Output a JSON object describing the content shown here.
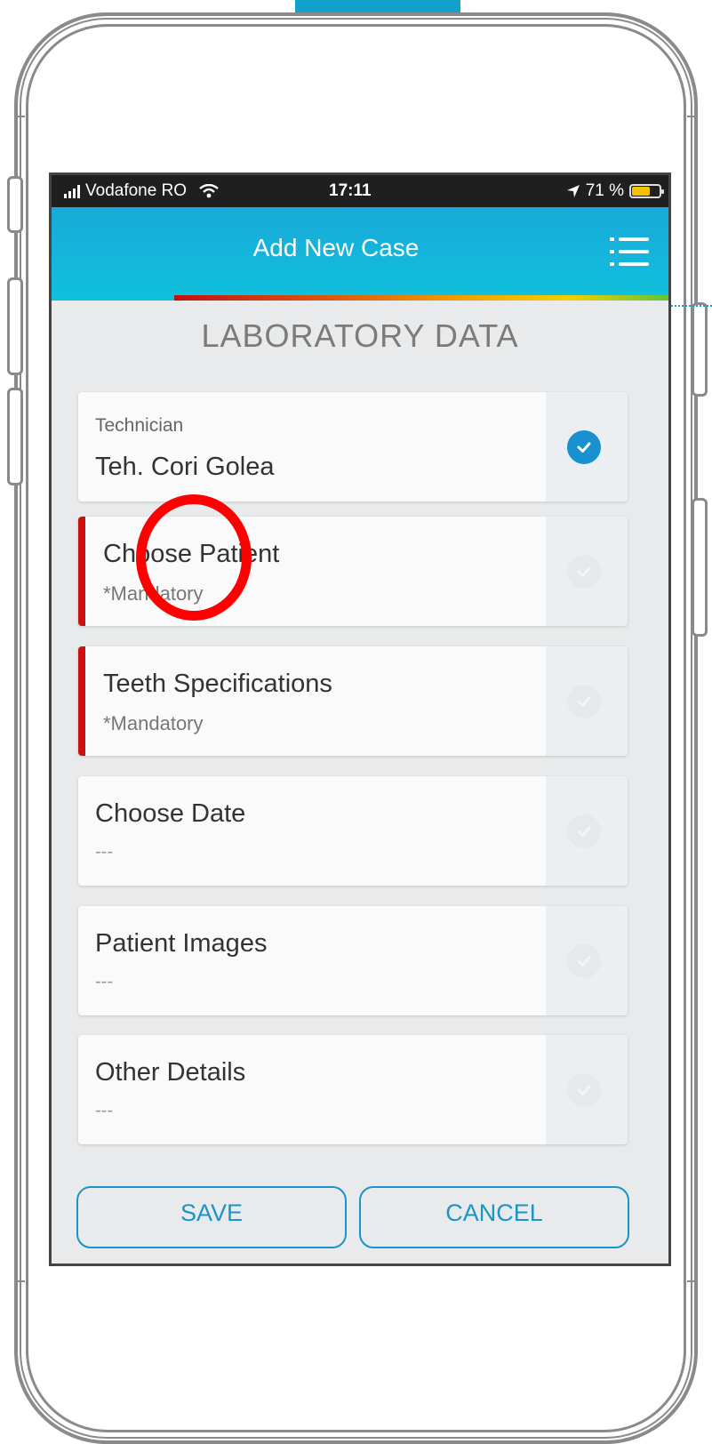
{
  "status_bar": {
    "carrier": "Vodafone RO",
    "time": "17:11",
    "battery_percent": "71 %",
    "battery_level": 0.71
  },
  "app_bar": {
    "title": "Add New Case",
    "menu_icon": "list-menu-icon"
  },
  "section_title": "LABORATORY DATA",
  "cards": [
    {
      "label": "Technician",
      "value": "Teh. Cori Golea",
      "complete": true
    },
    {
      "label": "Choose Patient",
      "value": "*Mandatory",
      "mandatory": true,
      "complete": false
    },
    {
      "label": "Teeth Specifications",
      "value": "*Mandatory",
      "mandatory": true,
      "complete": false
    },
    {
      "label": "Choose Date",
      "value": "---",
      "complete": false
    },
    {
      "label": "Patient Images",
      "value": "---",
      "complete": false
    },
    {
      "label": "Other Details",
      "value": "---",
      "complete": false
    }
  ],
  "buttons": {
    "save": "SAVE",
    "cancel": "CANCEL"
  },
  "colors": {
    "accent": "#1a95c8",
    "mandatory_stripe": "#cc1010",
    "annotation": "#ff0000"
  }
}
